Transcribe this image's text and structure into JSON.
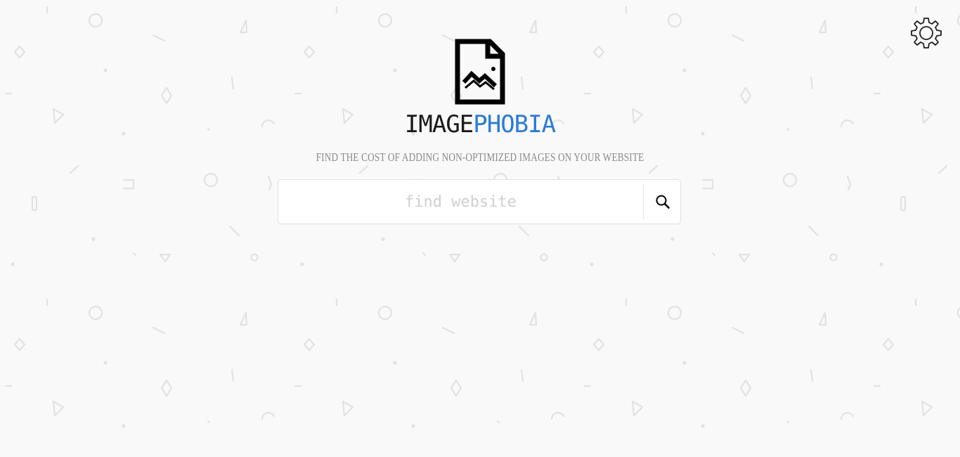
{
  "app": {
    "brand_part1": "IMAGE",
    "brand_part2": "PHOBIA",
    "tagline": "FIND THE COST OF ADDING NON-OPTIMIZED IMAGES ON YOUR WEBSITE"
  },
  "search": {
    "placeholder": "find website",
    "value": "",
    "button_icon": "search-icon"
  },
  "header": {
    "settings_icon": "gear-icon"
  },
  "colors": {
    "brand_dark": "#1a1a1a",
    "brand_accent": "#2b7bd6",
    "background": "#f9f9f9",
    "pattern": "#e2e2e2"
  }
}
